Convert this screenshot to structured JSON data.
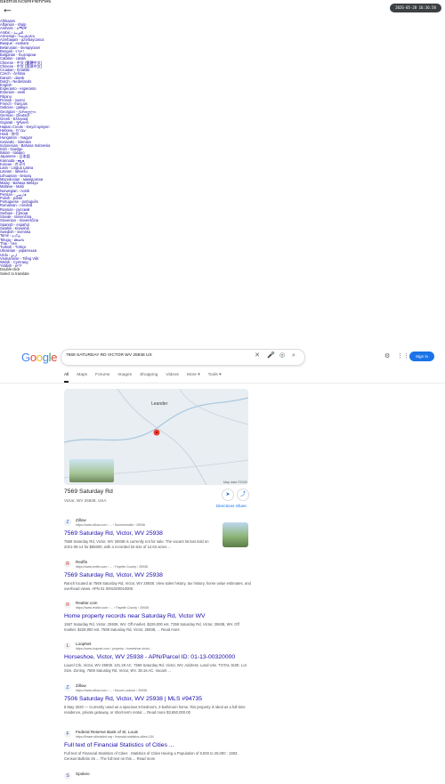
{
  "topbar": {
    "back_label": "←",
    "tiny_overlay": "BadmWXicwMPNmHA6",
    "clock": "2026-05-28 16:36:58"
  },
  "languages": [
    "Afrikaans",
    "Albanian - shqip",
    "Amharic - አማርኛ",
    "Arabic - العربية",
    "Armenian - հայերեն",
    "Azerbaijani - azərbaycanca",
    "Basque - euskara",
    "Belarusian - беларуская",
    "Bengali - বাংলা",
    "Bulgarian - български",
    "Catalan - català",
    "Chinese - 中文 (繁體中文)",
    "Chinese - 中文 (简体中文)",
    "Croatian - hrvatski",
    "Czech - čeština",
    "Danish - dansk",
    "Dutch - Nederlands",
    "English",
    "Esperanto - esperanto",
    "Estonian - eesti",
    "Filipino",
    "Finnish - suomi",
    "French - français",
    "Galician - galego",
    "Georgian - ქართული",
    "German - Deutsch",
    "Greek - Ελληνικά",
    "Gujarati - ગુજરાતી",
    "Haitian Creole - kreyòl ayisyen",
    "Hebrew - עברית",
    "Hindi - हिन्दी",
    "Hungarian - magyar",
    "Icelandic - íslenska",
    "Indonesian - Bahasa Indonesia",
    "Irish - Gaeilge",
    "Italian - italiano",
    "Japanese - 日本語",
    "Kannada - ಕನ್ನಡ",
    "Korean - 한국어",
    "Latin - Lingua Latina",
    "Latvian - latviešu",
    "Lithuanian - lietuvių",
    "Macedonian - македонски",
    "Malay - Bahasa Melayu",
    "Maltese - Malti",
    "Norwegian - norsk",
    "Persian - فارسی",
    "Polish - polski",
    "Portuguese - português",
    "Romanian - română",
    "Russian - русский",
    "Serbian - Српски",
    "Slovak - slovenčina",
    "Slovenian - slovenščina",
    "Spanish - español",
    "Swahili - Kiswahili",
    "Swedish - svenska",
    "Tamil - தமிழ்",
    "Telugu - తెలుగు",
    "Thai - ไทย",
    "Turkish - Türkçe",
    "Ukrainian - українська",
    "Urdu - اردو",
    "Vietnamese - Tiếng Việt",
    "Welsh - Cymraeg",
    "Yiddish - ייִדיש"
  ],
  "footer_lines": [
    "Double-click",
    "Select to translate"
  ],
  "header": {
    "logo": "Google",
    "query": "7569 SATURDAY RD VICTOR WV 25938 US",
    "signin": "Sign in"
  },
  "tabs": [
    "All",
    "Maps",
    "Forums",
    "Images",
    "Shopping",
    "Videos",
    "More ▾",
    "Tools ▾"
  ],
  "map": {
    "place_label": "Leander",
    "copyright": "Map data ©2026"
  },
  "place": {
    "title": "7569 Saturday Rd",
    "address": "Victor, WV 25938, USA",
    "actions": "Directions  Share"
  },
  "results": [
    {
      "source": "Zillow",
      "url": "https://www.zillow.com › ... › Summersville › 25938",
      "title": "7569 Saturday Rd, Victor, WV 25938",
      "snippet": "7569 Saturday Rd, Victor, WV 25938 is currently not for sale. The vacant lot last sold on 2021-06-14 for $65000, with a recorded lot size of 12.63 acres ..."
    },
    {
      "source": "Redfin",
      "url": "https://www.redfin.com › ... › Fayette County › 25938",
      "title": "7569 Saturday Rd, Victor, WV 25938",
      "snippet": "Ranch located at 7569 Saturday Rd, Victor, WV 25938. View sales history, tax history, home value estimates, and overhead views. APN 01 0001000010000."
    },
    {
      "source": "Realtor.com",
      "url": "https://www.realtor.com › ... › Fayette County › 25938",
      "title": "Home property records near Saturday Rd, Victor WV",
      "snippet": "1557 Saturday Rd, Victor, 25938, WV. Off market. $229,000 est. 7359 Saturday Rd, Victor, 25938, WV. Off market. $228,900 est. 7569 Saturday Rd, Victor, 25938, ... Read more"
    },
    {
      "source": "LoopNet",
      "url": "https://www.loopnet.com › property › horseshoe-victor...",
      "title": "Horseshoe, Victor, WV 25938 - APN/Parcel ID: 01-13-00320000",
      "snippet": "Laurel Crk, Victor, WV 25938. 101.29 AC. 7569 Saturday Rd, Victor, WV. Address. Land Use. TOTAL SIZE. Lot Size. Zoning. 7569 Saturday Rd, Victor, WV. 38.16 AC. Vacant ..."
    },
    {
      "source": "Zillow",
      "url": "https://www.zillow.com › ... › Mount Lookout › 25938",
      "title": "7506 Saturday Rd, Victor, WV 25938 | MLS #94735",
      "snippet": "8 May 2020 — Currently used as a spacious 5-bedroom, 2-bathroom home, this property is ideal as a full-time residence, private getaway, or short-term rental ... Read more\n$3,650,000.00"
    },
    {
      "source": "Federal Reserve Bank of St. Louis",
      "url": "https://fraser.stlouisfed.org › financial-statistics-cities-154",
      "title": "Full text of Financial Statistics of Cities ...",
      "snippet": "Full text of Financial Statistics of Cities . Statistics of Cities Having a Population of 8,000 to 25,000 : 1903. Census Bulletin 45 ... The full text on this ... Read more"
    },
    {
      "source": "Spokeo",
      "url": "",
      "title": "",
      "snippet": ""
    }
  ]
}
